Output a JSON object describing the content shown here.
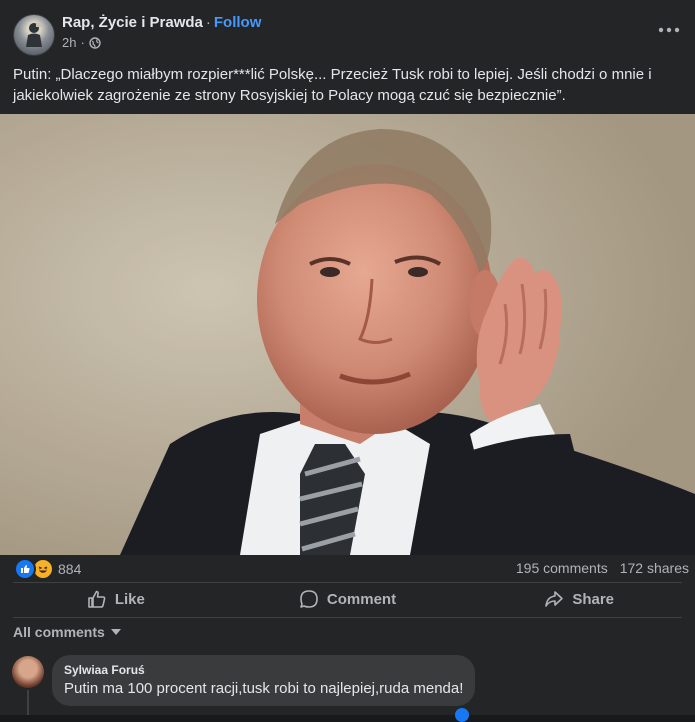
{
  "post": {
    "page_name": "Rap, Życie i Prawda",
    "separator": "·",
    "follow_label": "Follow",
    "time": "2h",
    "time_separator": "·",
    "audience_icon": "globe-icon",
    "more_icon": "more-options-icon",
    "caption": "Putin: „Dlaczego miałbym rozpier***lić Polskę... Przecież Tusk robi to lepiej. Jeśli chodzi o mnie i jakiekolwiek zagrożenie ze strony Rosyjskiej to Polacy mogą czuć się bezpiecznie”."
  },
  "stats": {
    "reaction_icons": [
      "like-reaction-icon",
      "haha-reaction-icon"
    ],
    "reaction_count": "884",
    "comments": "195 comments",
    "shares": "172 shares"
  },
  "actions": {
    "like": "Like",
    "comment": "Comment",
    "share": "Share"
  },
  "comments_section": {
    "filter_label": "All comments",
    "items": [
      {
        "author": "Sylwiaa Foruś",
        "text": "Putin ma 100 procent racji,tusk robi to najlepiej,ruda menda!"
      }
    ]
  },
  "colors": {
    "background": "#242526",
    "follow_link": "#4599ff",
    "like_blue": "#1877f2",
    "haha_yellow": "#f7b125",
    "muted_text": "#b0b3b8"
  }
}
